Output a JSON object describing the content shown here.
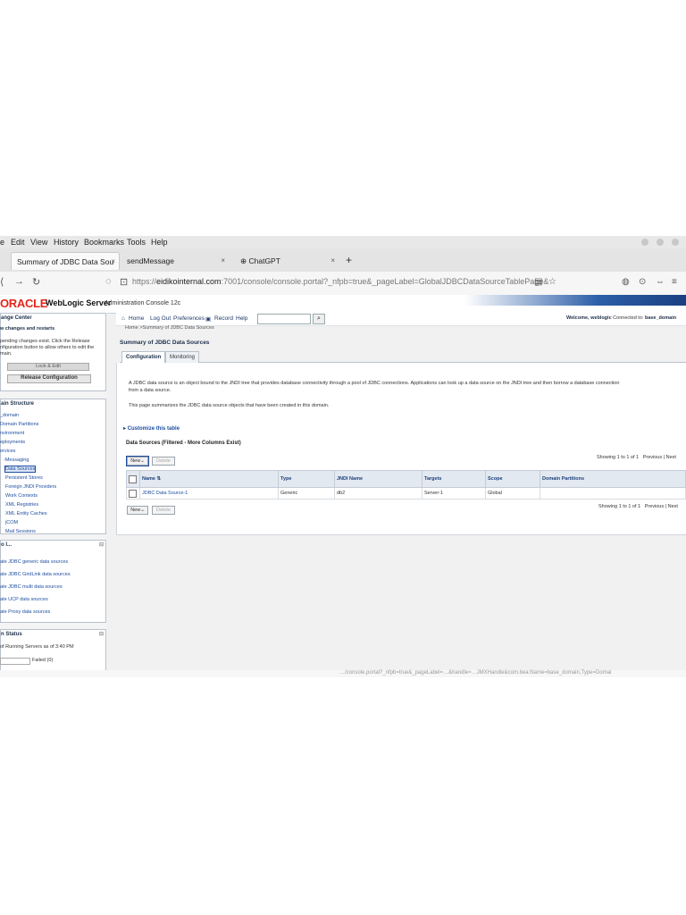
{
  "menubar": [
    "e",
    "Edit",
    "View",
    "History",
    "Bookmarks",
    "Tools",
    "Help"
  ],
  "tabs": [
    {
      "label": "Summary of JDBC Data Sou",
      "close": "×"
    },
    {
      "label": "sendMessage",
      "close": "×"
    },
    {
      "label": "ChatGPT",
      "close": "×"
    }
  ],
  "new_tab": "+",
  "url": {
    "prefix": "https://",
    "host": "eidikointernal.com",
    "rest": ":7001/console/console.portal?_nfpb=true&_pageLabel=GlobalJDBCDataSourceTablePage&"
  },
  "header": {
    "logo": "ORACLE",
    "product": "WebLogic Server",
    "subtitle": "Administration Console 12c"
  },
  "toolbar": {
    "home": "Home",
    "logout": "Log Out",
    "preferences": "Preferences",
    "record": "Record",
    "help": "Help",
    "welcome": "Welcome, weblogic",
    "connected": "Connected to:",
    "domain": "base_domain"
  },
  "change_center": {
    "title": "ange Center",
    "link": "w changes and restarts",
    "text1": "pending changes exist. Click the Release",
    "text2": "nfiguration button to allow others to edit the",
    "text3": "main.",
    "lock_label": "Lock & Edit",
    "release_label": "Release Configuration"
  },
  "domain_structure": {
    "title": "ain Structure",
    "items": [
      "_domain",
      "Domain Partitions",
      "nvironment",
      "eployments",
      "ervices",
      "-Messaging",
      "Data Sources",
      "Persistent Stores",
      "Foreign JNDI Providers",
      "Work Contexts",
      "XML Registries",
      "XML Entity Caches",
      "jCOM",
      "Mail Sessions"
    ]
  },
  "how_do_i": {
    "title": "o I...",
    "items": [
      "ate JDBC generic data sources",
      "ate JDBC GridLink data sources",
      "ate JDBC multi data sources",
      "ate UCP data sources",
      "ate Proxy data sources"
    ]
  },
  "system_status": {
    "title": "n Status",
    "line": "of Running Servers as of  3:40 PM",
    "failed": "Failed (0)"
  },
  "page": {
    "breadcrumb": "Home >Summary of JDBC Data Sources",
    "title": "Summary of JDBC Data Sources",
    "tab_config": "Configuration",
    "tab_monitor": "Monitoring",
    "desc1": "A JDBC data source is an object bound to the JNDI tree that provides database connectivity through a pool of JDBC connections. Applications can look up a data source on the JNDI tree and then borrow a database connection",
    "desc1b": "from a data source.",
    "desc2": "This page summarizes the JDBC data source objects that have been created in this domain.",
    "customize": "Customize this table",
    "table_title": "Data Sources (Filtered - More Columns Exist)",
    "new_label": "New",
    "delete_label": "Delete",
    "showing": "Showing 1 to 1 of 1",
    "previous": "Previous",
    "next": "Next"
  },
  "table": {
    "headers": [
      "Name",
      "Type",
      "JNDI Name",
      "Targets",
      "Scope",
      "Domain Partitions"
    ],
    "rows": [
      [
        "JDBC Data Source-1",
        "Generic",
        "db2",
        "Server-1",
        "Global",
        ""
      ]
    ]
  },
  "statusbar": "…/console.portal?_nfpb=true&_pageLabel=…&handle=…JMXHandle&com.bea:Name=base_domain,Type=Domai"
}
